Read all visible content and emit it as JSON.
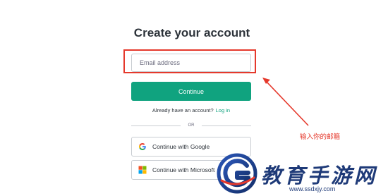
{
  "form": {
    "title": "Create your account",
    "email_placeholder": "Email address",
    "email_value": "",
    "continue_label": "Continue",
    "have_account_text": "Already have an account?",
    "login_link": "Log in",
    "divider_text": "OR",
    "google_label": "Continue with Google",
    "microsoft_label": "Continue with Microsoft"
  },
  "annotation": {
    "text": "输入你的邮箱",
    "color": "#e5392c"
  },
  "watermark": {
    "title": "教育手游网",
    "url": "www.ssdxjy.com",
    "color": "#1e3a78"
  },
  "colors": {
    "accent": "#10a37f",
    "highlight": "#e5392c"
  }
}
